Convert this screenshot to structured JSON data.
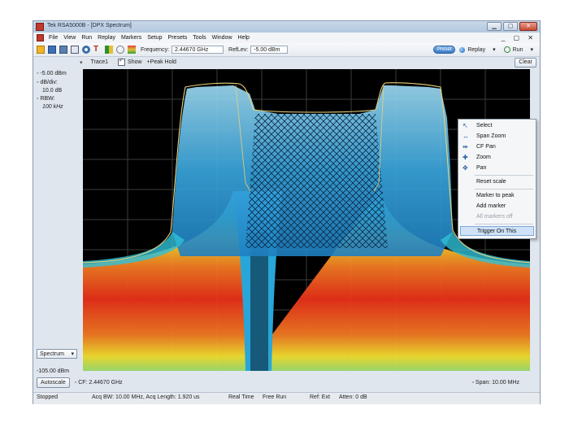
{
  "window": {
    "title": "Tek RSA5000B - [DPX Spectrum]"
  },
  "window_buttons": {
    "minimize": "▁",
    "maximize": "▢",
    "close": "✕"
  },
  "menu": {
    "items": [
      "File",
      "View",
      "Run",
      "Replay",
      "Markers",
      "Setup",
      "Presets",
      "Tools",
      "Window",
      "Help"
    ],
    "right_controls": "_ ▢ ✕"
  },
  "toolbar": {
    "frequency_label": "Frequency:",
    "frequency_value": "2.44670 GHz",
    "reflev_label": "RefLev:",
    "reflev_value": "-5.00 dBm",
    "preset_label": "Preset",
    "replay_label": "Replay",
    "replay_menu": "▾",
    "run_label": "Run",
    "run_menu": "▾"
  },
  "tracebar": {
    "chevron": "▾",
    "trace_label": "Trace1",
    "show_label": "Show",
    "hold_label": "+Peak Hold",
    "clear_label": "Clear"
  },
  "left_panel": {
    "ref_level": "-5.00 dBm",
    "db_div_label": "dB/div:",
    "db_div_value": "10.0 dB",
    "rbw_label": "RBW:",
    "rbw_value": "100 kHz",
    "bottom_level": "-105.00 dBm",
    "view_select": "Spectrum"
  },
  "context_menu": {
    "items": [
      {
        "label": "Select",
        "icon": "select-arrow-icon"
      },
      {
        "label": "Span Zoom",
        "icon": "span-zoom-icon"
      },
      {
        "label": "CF Pan",
        "icon": "cf-pan-icon"
      },
      {
        "label": "Zoom",
        "icon": "zoom-icon"
      },
      {
        "label": "Pan",
        "icon": "pan-icon"
      },
      {
        "label": "Reset scale"
      },
      {
        "label": "Marker to peak"
      },
      {
        "label": "Add marker"
      },
      {
        "label": "All markers off",
        "disabled": true
      },
      {
        "label": "Trigger On This",
        "highlighted": true
      }
    ]
  },
  "bottom": {
    "autoscale_label": "Autoscale",
    "cf_text": "CF: 2.44670 GHz",
    "span_text": "Span: 10.00 MHz"
  },
  "status": {
    "state": "Stopped",
    "acq": "Acq BW: 10.00 MHz, Acq Length: 1.920 us",
    "mode": "Real Time",
    "trigger": "Free Run",
    "ref": "Ref: Ext",
    "atten": "Atten: 0 dB"
  },
  "colors": {
    "plot_bg": "#000000",
    "grid": "#3b3b3b",
    "trace": "#e8d27a",
    "density_low": "#2fa6e6",
    "density_high": "#e8301a",
    "highlight": "#cfe2f7"
  }
}
